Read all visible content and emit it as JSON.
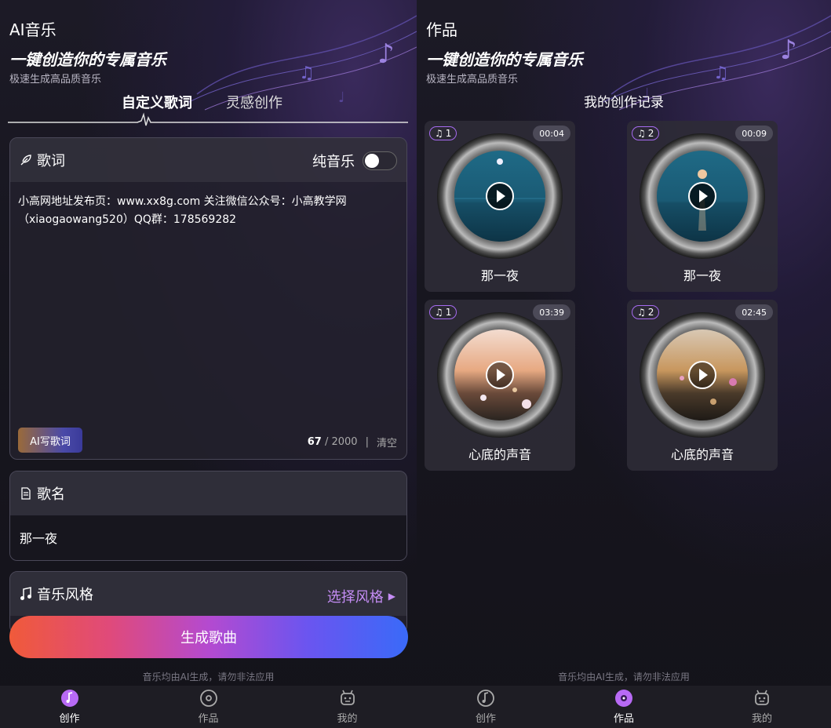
{
  "left": {
    "title": "AI音乐",
    "headline": "一键创造你的专属音乐",
    "subline": "极速生成高品质音乐",
    "tabs": [
      {
        "label": "自定义歌词",
        "active": true
      },
      {
        "label": "灵感创作",
        "active": false
      }
    ],
    "lyrics": {
      "label": "歌词",
      "pure_music_label": "纯音乐",
      "pure_music_on": false,
      "text": "小高网地址发布页：www.xx8g.com 关注微信公众号：小高教学网（xiaogaowang520）QQ群：178569282",
      "ai_button": "AI写歌词",
      "count": "67",
      "max": "/ 2000",
      "separator": "|",
      "clear": "清空"
    },
    "song_name": {
      "label": "歌名",
      "value": "那一夜"
    },
    "style": {
      "label": "音乐风格",
      "select": "选择风格"
    },
    "generate": "生成歌曲",
    "footnote": "音乐均由AI生成，请勿非法应用"
  },
  "right": {
    "title": "作品",
    "headline": "一键创造你的专属音乐",
    "subline": "极速生成高品质音乐",
    "section_title": "我的创作记录",
    "works": [
      {
        "track": "1",
        "duration": "00:04",
        "title": "那一夜",
        "cover": "night-sea-moon"
      },
      {
        "track": "2",
        "duration": "00:09",
        "title": "那一夜",
        "cover": "night-sea-sunset"
      },
      {
        "track": "1",
        "duration": "03:39",
        "title": "心底的声音",
        "cover": "flowers-sunset"
      },
      {
        "track": "2",
        "duration": "02:45",
        "title": "心底的声音",
        "cover": "flowers-dusk"
      }
    ],
    "footnote": "音乐均由AI生成，请勿非法应用"
  },
  "nav": {
    "left": [
      {
        "label": "创作",
        "icon": "music-note-icon",
        "active": true
      },
      {
        "label": "作品",
        "icon": "disc-icon",
        "active": false
      },
      {
        "label": "我的",
        "icon": "robot-icon",
        "active": false
      }
    ],
    "right": [
      {
        "label": "创作",
        "icon": "music-note-icon",
        "active": false
      },
      {
        "label": "作品",
        "icon": "disc-icon",
        "active": true
      },
      {
        "label": "我的",
        "icon": "robot-icon",
        "active": false
      }
    ]
  },
  "colors": {
    "accent": "#a66bf0",
    "select": "#c58df5"
  }
}
